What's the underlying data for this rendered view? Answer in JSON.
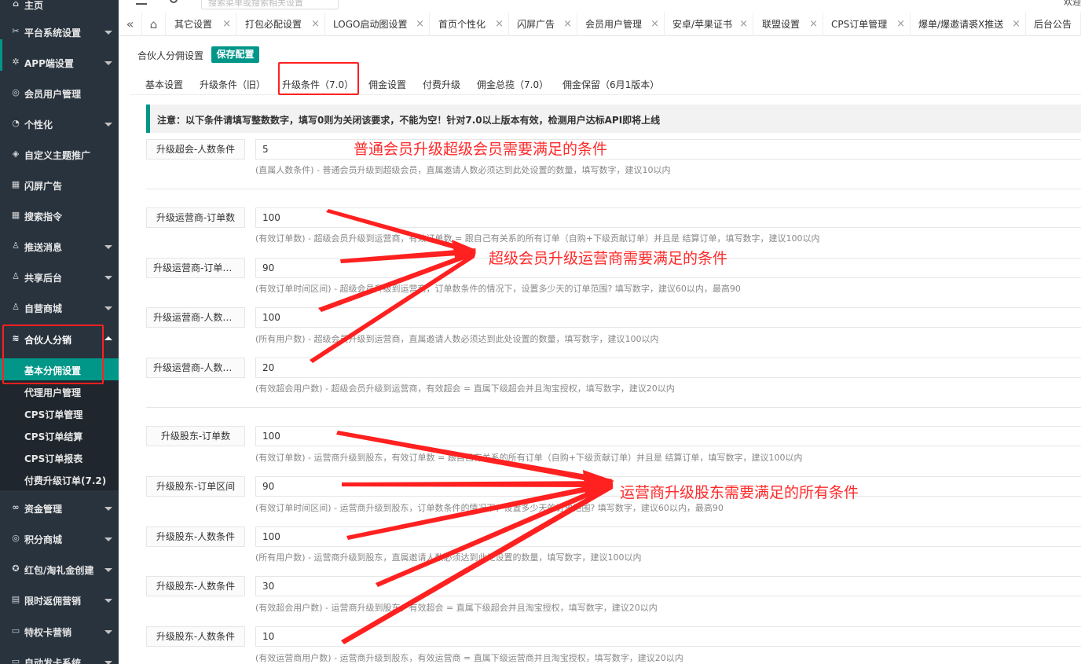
{
  "sidebar": {
    "items": [
      {
        "label": "主页",
        "icon": "home-icon",
        "glyph": "⌂"
      },
      {
        "label": "平台系统设置",
        "icon": "tools-icon",
        "glyph": "✂"
      },
      {
        "label": "APP端设置",
        "icon": "gear-icon",
        "glyph": "✲"
      },
      {
        "label": "会员用户管理",
        "icon": "shield-icon",
        "glyph": "◎"
      },
      {
        "label": "个性化",
        "icon": "palette-icon",
        "glyph": "◔"
      },
      {
        "label": "自定义主题推广",
        "icon": "cube-icon",
        "glyph": "◈"
      },
      {
        "label": "闪屏广告",
        "icon": "grid-icon",
        "glyph": "▦"
      },
      {
        "label": "搜索指令",
        "icon": "grid-icon",
        "glyph": "▦"
      },
      {
        "label": "推送消息",
        "icon": "user-icon",
        "glyph": "♙"
      },
      {
        "label": "共享后台",
        "icon": "user-icon",
        "glyph": "♙"
      },
      {
        "label": "自营商城",
        "icon": "user-icon",
        "glyph": "♙"
      },
      {
        "label": "合伙人分销",
        "icon": "layers-icon",
        "glyph": "≋"
      }
    ],
    "submenu": [
      "基本分佣设置",
      "代理用户管理",
      "CPS订单管理",
      "CPS订单结算",
      "CPS订单报表",
      "付费升级订单(7.2)"
    ],
    "items_after": [
      {
        "label": "资金管理",
        "icon": "link-icon",
        "glyph": "∞"
      },
      {
        "label": "积分商城",
        "icon": "shield-icon",
        "glyph": "◎"
      },
      {
        "label": "红包/淘礼金创建",
        "icon": "gift-icon",
        "glyph": "✪"
      },
      {
        "label": "限时返佣营销",
        "icon": "calendar-icon",
        "glyph": "▤"
      },
      {
        "label": "特权卡营销",
        "icon": "card-icon",
        "glyph": "▭"
      },
      {
        "label": "自动发卡系统",
        "icon": "card-icon",
        "glyph": "▭"
      }
    ]
  },
  "topbar": {
    "search_placeholder": "搜索菜单或搜索相关设置",
    "user_text": "欢迎"
  },
  "tabs": [
    "其它设置",
    "打包必配设置",
    "LOGO启动图设置",
    "首页个性化",
    "闪屏广告",
    "会员用户管理",
    "安卓/苹果证书",
    "联盟设置",
    "CPS订单管理",
    "爆单/爆邀请裘X推送",
    "后台公告"
  ],
  "page": {
    "title": "合伙人分佣设置",
    "save_label": "保存配置",
    "subtabs": [
      "基本设置",
      "升级条件（旧）",
      "升级条件（7.0）",
      "佣金设置",
      "付费升级",
      "佣金总揽（7.0）",
      "佣金保留（6月1版本）"
    ],
    "notice": "注意：以下条件请填写整数数字，填写0则为关闭该要求，不能为空！针对7.0以上版本有效，检测用户达标API即将上线"
  },
  "form": {
    "rows": [
      {
        "label": "升级超会-人数条件",
        "value": "5",
        "help": "(直属人数条件) - 普通会员升级到超级会员，直属邀请人数必须达到此处设置的数量，填写数字，建议10以内"
      },
      {
        "label": "升级运营商-订单数",
        "value": "100",
        "help": "(有效订单数) - 超级会员升级到运营商，有效订单数 = 跟自己有关系的所有订单（自购+下级贡献订单）并且是 结算订单，填写数字，建议100以内"
      },
      {
        "label": "升级运营商-订单区间",
        "value": "90",
        "help": "(有效订单时间区间) - 超级会员升级到运营商，订单数条件的情况下，设置多少天的订单范围? 填写数字，建议60以内，最高90"
      },
      {
        "label": "升级运营商-人数条件",
        "value": "100",
        "help": "(所有用户数) - 超级会员升级到运营商，直属邀请人数必须达到此处设置的数量，填写数字，建议100以内"
      },
      {
        "label": "升级运营商-人数条件",
        "value": "20",
        "help": "(有效超会用户数) - 超级会员升级到运营商，有效超会 = 直属下级超会并且淘宝授权，填写数字，建议20以内"
      },
      {
        "label": "升级股东-订单数",
        "value": "100",
        "help": "(有效订单数) - 运营商升级到股东，有效订单数 = 跟自己有关系的所有订单（自购+下级贡献订单）并且是 结算订单，填写数字，建议100以内"
      },
      {
        "label": "升级股东-订单区间",
        "value": "90",
        "help": "(有效订单时间区间) - 运营商升级到股东，订单数条件的情况下，设置多少天的订单范围? 填写数字，建议60以内，最高90"
      },
      {
        "label": "升级股东-人数条件",
        "value": "100",
        "help": "(所有用户数) - 运营商升级到股东，直属邀请人数必须达到此处设置的数量，填写数字，建议100以内"
      },
      {
        "label": "升级股东-人数条件",
        "value": "30",
        "help": "(有效超会用户数) - 运营商升级到股东，有效超会 = 直属下级超会并且淘宝授权，填写数字，建议20以内"
      },
      {
        "label": "升级股东-人数条件",
        "value": "10",
        "help": "(有效运营商用户数) - 运营商升级到股东，有效运营商 = 直属下级运营商并且淘宝授权，填写数字，建议20以内"
      }
    ]
  },
  "annotations": {
    "note1": "普通会员升级超级会员需要满足的条件",
    "note2": "超级会员升级运营商需要满足的条件",
    "note3": "运营商升级股东需要满足的所有条件",
    "color": "#ff2a2a"
  }
}
